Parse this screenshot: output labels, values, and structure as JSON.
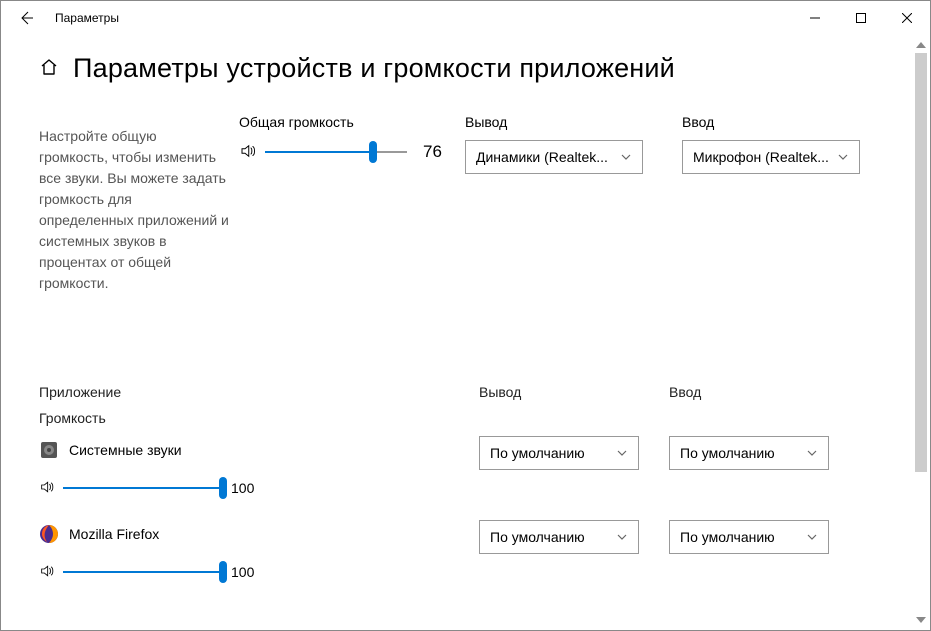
{
  "window": {
    "title": "Параметры"
  },
  "page": {
    "heading": "Параметры устройств и громкости приложений",
    "description": "Настройте общую громкость, чтобы изменить все звуки. Вы можете задать громкость для определенных приложений и системных звуков в процентах от общей громкости."
  },
  "master": {
    "volume_label": "Общая громкость",
    "volume_value": "76",
    "volume_percent": 76,
    "output_label": "Вывод",
    "output_selected": "Динамики (Realtek...",
    "input_label": "Ввод",
    "input_selected": "Микрофон (Realtek..."
  },
  "columns": {
    "app": "Приложение",
    "volume": "Громкость",
    "output": "Вывод",
    "input": "Ввод"
  },
  "default_option": "По умолчанию",
  "apps": [
    {
      "name": "Системные звуки",
      "icon": "speaker-box",
      "volume": 100,
      "volume_text": "100",
      "output": "По умолчанию",
      "input": "По умолчанию"
    },
    {
      "name": "Mozilla Firefox",
      "icon": "firefox",
      "volume": 100,
      "volume_text": "100",
      "output": "По умолчанию",
      "input": "По умолчанию"
    }
  ]
}
